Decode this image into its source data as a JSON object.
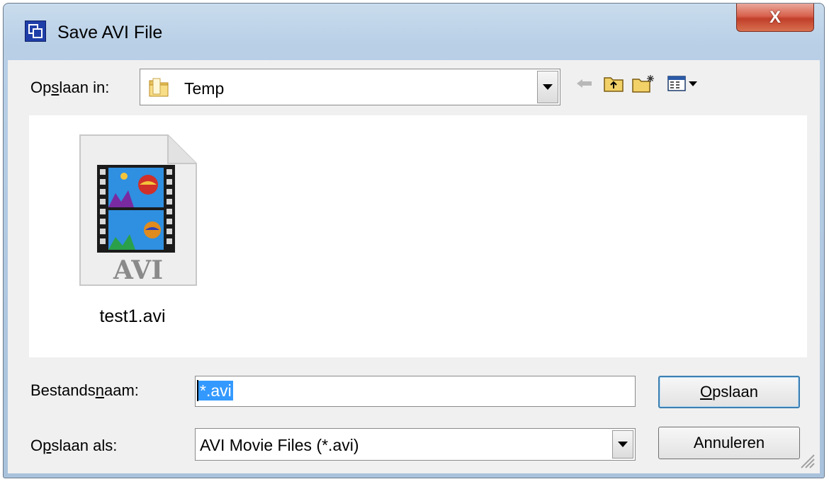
{
  "window": {
    "title": "Save AVI File",
    "close_glyph": "X"
  },
  "lookin": {
    "label_pre": "Op",
    "label_accel": "s",
    "label_post": "laan in:",
    "folder": "Temp",
    "icons": [
      "back-arrow-icon",
      "up-folder-icon",
      "new-folder-icon",
      "view-menu-icon"
    ]
  },
  "files": [
    {
      "name": "test1.avi",
      "badge": "AVI",
      "icon": "avi-video-file-icon"
    }
  ],
  "filename": {
    "label_pre": "Bestands",
    "label_accel": "n",
    "label_post": "aam:",
    "value": "*.avi"
  },
  "filetype": {
    "label_pre": "O",
    "label_accel": "p",
    "label_post": "slaan als:",
    "value": "AVI Movie Files (*.avi)"
  },
  "buttons": {
    "save_accel": "O",
    "save_rest": "pslaan",
    "cancel": "Annuleren"
  },
  "colors": {
    "selection": "#3399ff",
    "close": "#c13f2a",
    "dialog_bg": "#f0f0f0"
  }
}
